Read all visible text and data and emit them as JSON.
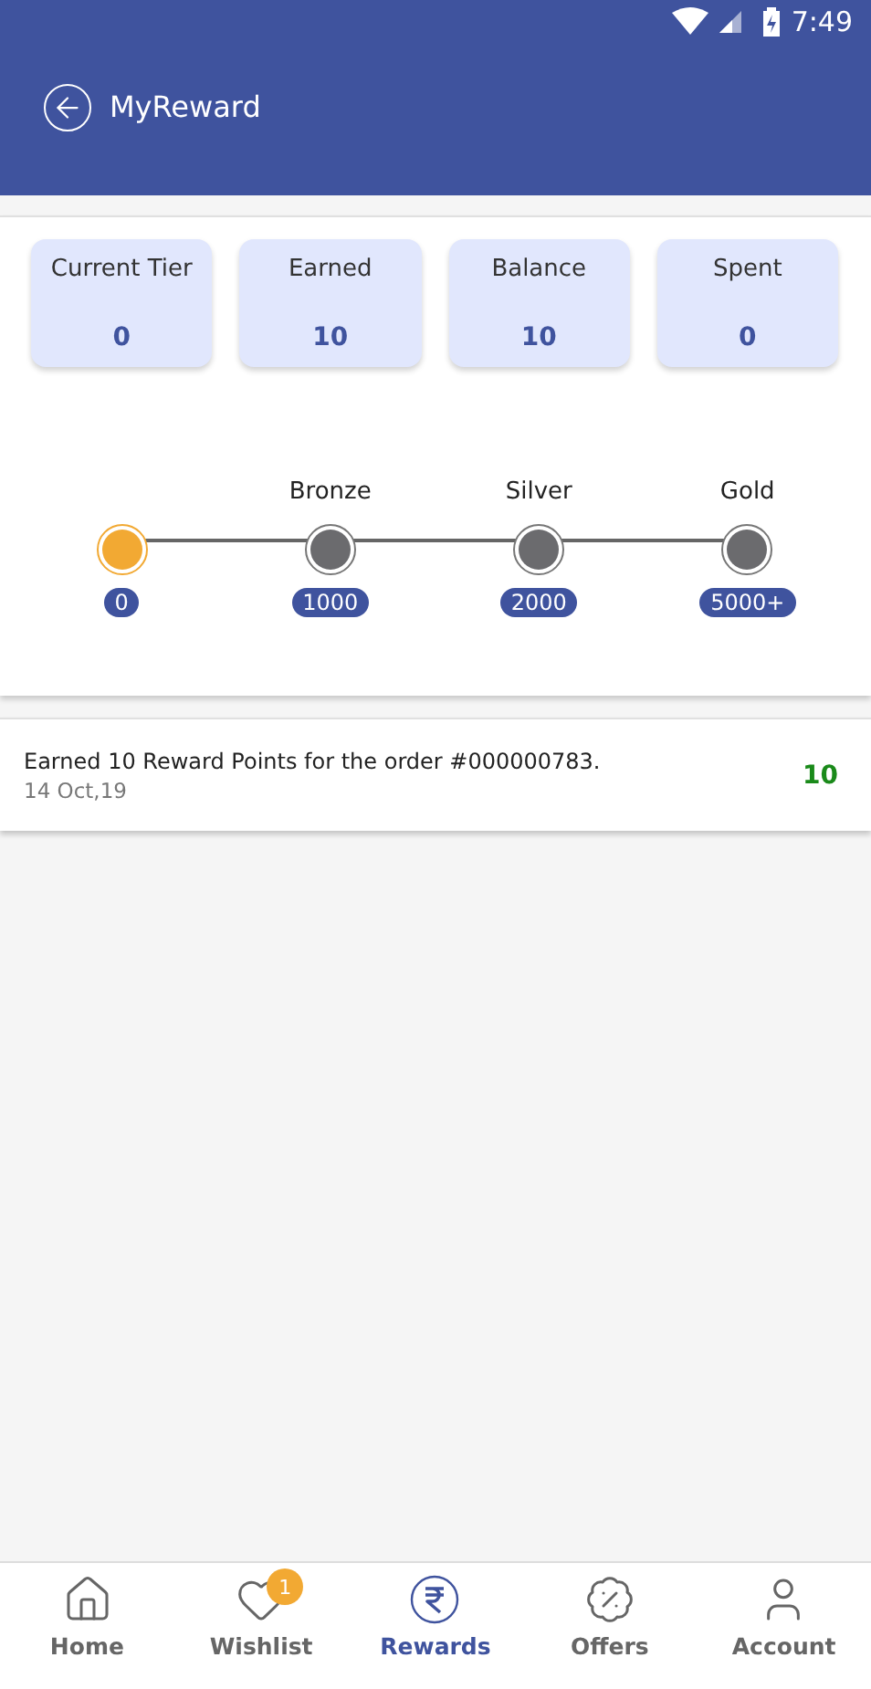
{
  "status_bar": {
    "time": "7:49"
  },
  "header": {
    "title": "MyReward"
  },
  "stats": [
    {
      "label": "Current Tier",
      "value": "0"
    },
    {
      "label": "Earned",
      "value": "10"
    },
    {
      "label": "Balance",
      "value": "10"
    },
    {
      "label": "Spent",
      "value": "0"
    }
  ],
  "tiers": [
    {
      "points": "0",
      "selected": true
    },
    {
      "name": "Bronze",
      "points": "1000",
      "selected": false
    },
    {
      "name": "Silver",
      "points": "2000",
      "selected": false
    },
    {
      "name": "Gold",
      "points": "5000+",
      "selected": false
    }
  ],
  "transactions": [
    {
      "text": "Earned 10 Reward Points for the order #000000783.",
      "date": "14 Oct,19",
      "points": "10"
    }
  ],
  "bottom_nav": [
    {
      "kind": "home",
      "label": "Home",
      "selected": false
    },
    {
      "kind": "wishlist",
      "label": "Wishlist",
      "selected": false,
      "badge": "1"
    },
    {
      "kind": "rewards",
      "label": "Rewards",
      "selected": true
    },
    {
      "kind": "offers",
      "label": "Offers",
      "selected": false
    },
    {
      "kind": "account",
      "label": "Account",
      "selected": false
    }
  ]
}
